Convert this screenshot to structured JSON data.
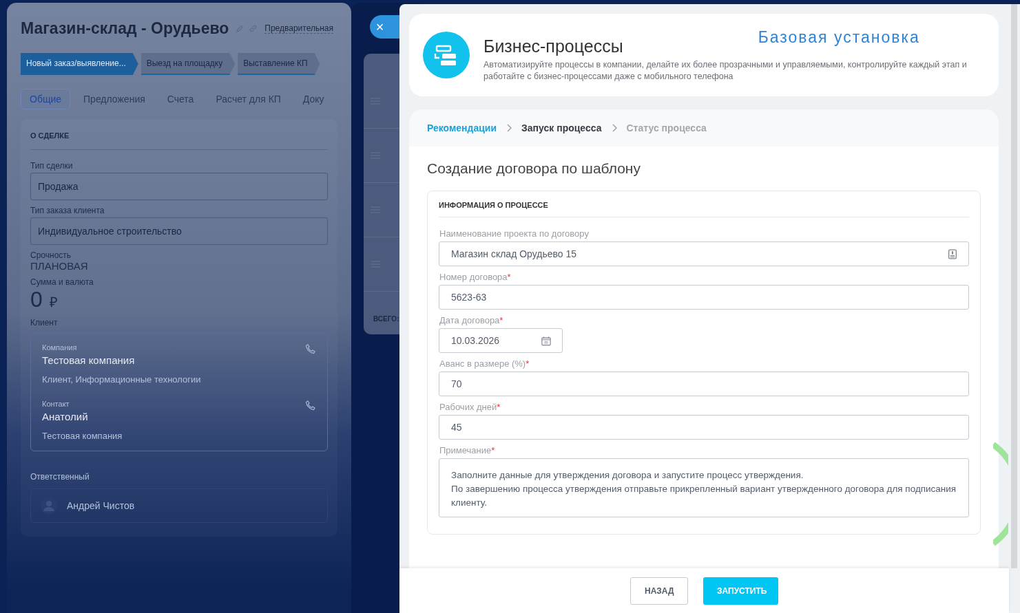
{
  "deal_card": {
    "title": "Магазин-склад - Орудьево",
    "status_link": "Предварительная",
    "stages": [
      {
        "label": "Новый заказ/выявление...",
        "selected": true
      },
      {
        "label": "Выезд на площадку",
        "selected": false
      },
      {
        "label": "Выставление КП",
        "selected": false
      }
    ],
    "tabs": [
      {
        "label": "Общие",
        "selected": true
      },
      {
        "label": "Предложения",
        "selected": false
      },
      {
        "label": "Счета",
        "selected": false
      },
      {
        "label": "Расчет для КП",
        "selected": false
      },
      {
        "label": "Доку",
        "selected": false
      }
    ],
    "section_title": "О СДЕЛКЕ",
    "fields": [
      {
        "kind": "select",
        "label": "Тип сделки",
        "value": "Продажа"
      },
      {
        "kind": "select",
        "label": "Тип заказа клиента",
        "value": "Индивидуальное строительство"
      },
      {
        "kind": "text",
        "label": "Срочность",
        "value": "ПЛАНОВАЯ"
      },
      {
        "kind": "money",
        "label": "Сумма и валюта",
        "value": "0",
        "currency": "₽"
      }
    ],
    "client_label": "Клиент",
    "client_entries": [
      {
        "label": "Компания",
        "name": "Тестовая компания",
        "details": "Клиент, Информационные технологии"
      },
      {
        "label": "Контакт",
        "name": "Анатолий",
        "details": "Тестовая компания"
      }
    ],
    "responsible_label": "Ответственный",
    "responsible_name": "Андрей Чистов"
  },
  "middle_panel": {
    "total_label": "ВСЕГО:",
    "close_icon": "×"
  },
  "process_panel": {
    "header": {
      "title": "Бизнес-процессы",
      "badge": "Базовая установка",
      "description": "Автоматизируйте процессы в компании, делайте их более прозрачными и управляемыми, контролируйте каждый этап и работайте с бизнес-процессами даже с мобильного телефона"
    },
    "steps": [
      {
        "label": "Рекомендации",
        "completed": true,
        "selected": false
      },
      {
        "label": "Запуск процесса",
        "completed": false,
        "selected": true
      },
      {
        "label": "Статус процесса",
        "completed": false,
        "selected": false
      }
    ],
    "form_title": "Создание договора по шаблону",
    "section_title": "ИНФОРМАЦИЯ О ПРОЦЕССЕ",
    "fields": [
      {
        "kind": "picker",
        "label": "Наименование проекта по договору",
        "value": "Магазин склад Орудьево 15"
      },
      {
        "kind": "text",
        "label": "Номер договора",
        "required_mark": "*",
        "value": "5623-63"
      },
      {
        "kind": "date",
        "label": "Дата договора",
        "required_mark": "*",
        "value": "10.03.2026"
      },
      {
        "kind": "text",
        "label": "Аванс в размере (%)",
        "required_mark": "*",
        "value": "70"
      },
      {
        "kind": "text",
        "label": "Рабочих дней",
        "required_mark": "*",
        "value": "45"
      },
      {
        "kind": "textarea",
        "label": "Примечание",
        "required_mark": "*",
        "value": "Заполните данные для утверждения договора и запустите процесс утверждения.\nПо завершению процесса утверждения отправьте прикрепленный вариант утвержденного договора для подписания клиенту."
      }
    ],
    "buttons": [
      {
        "label": "НАЗАД",
        "kind": "secondary"
      },
      {
        "label": "ЗАПУСТИТЬ",
        "kind": "primary"
      }
    ]
  }
}
